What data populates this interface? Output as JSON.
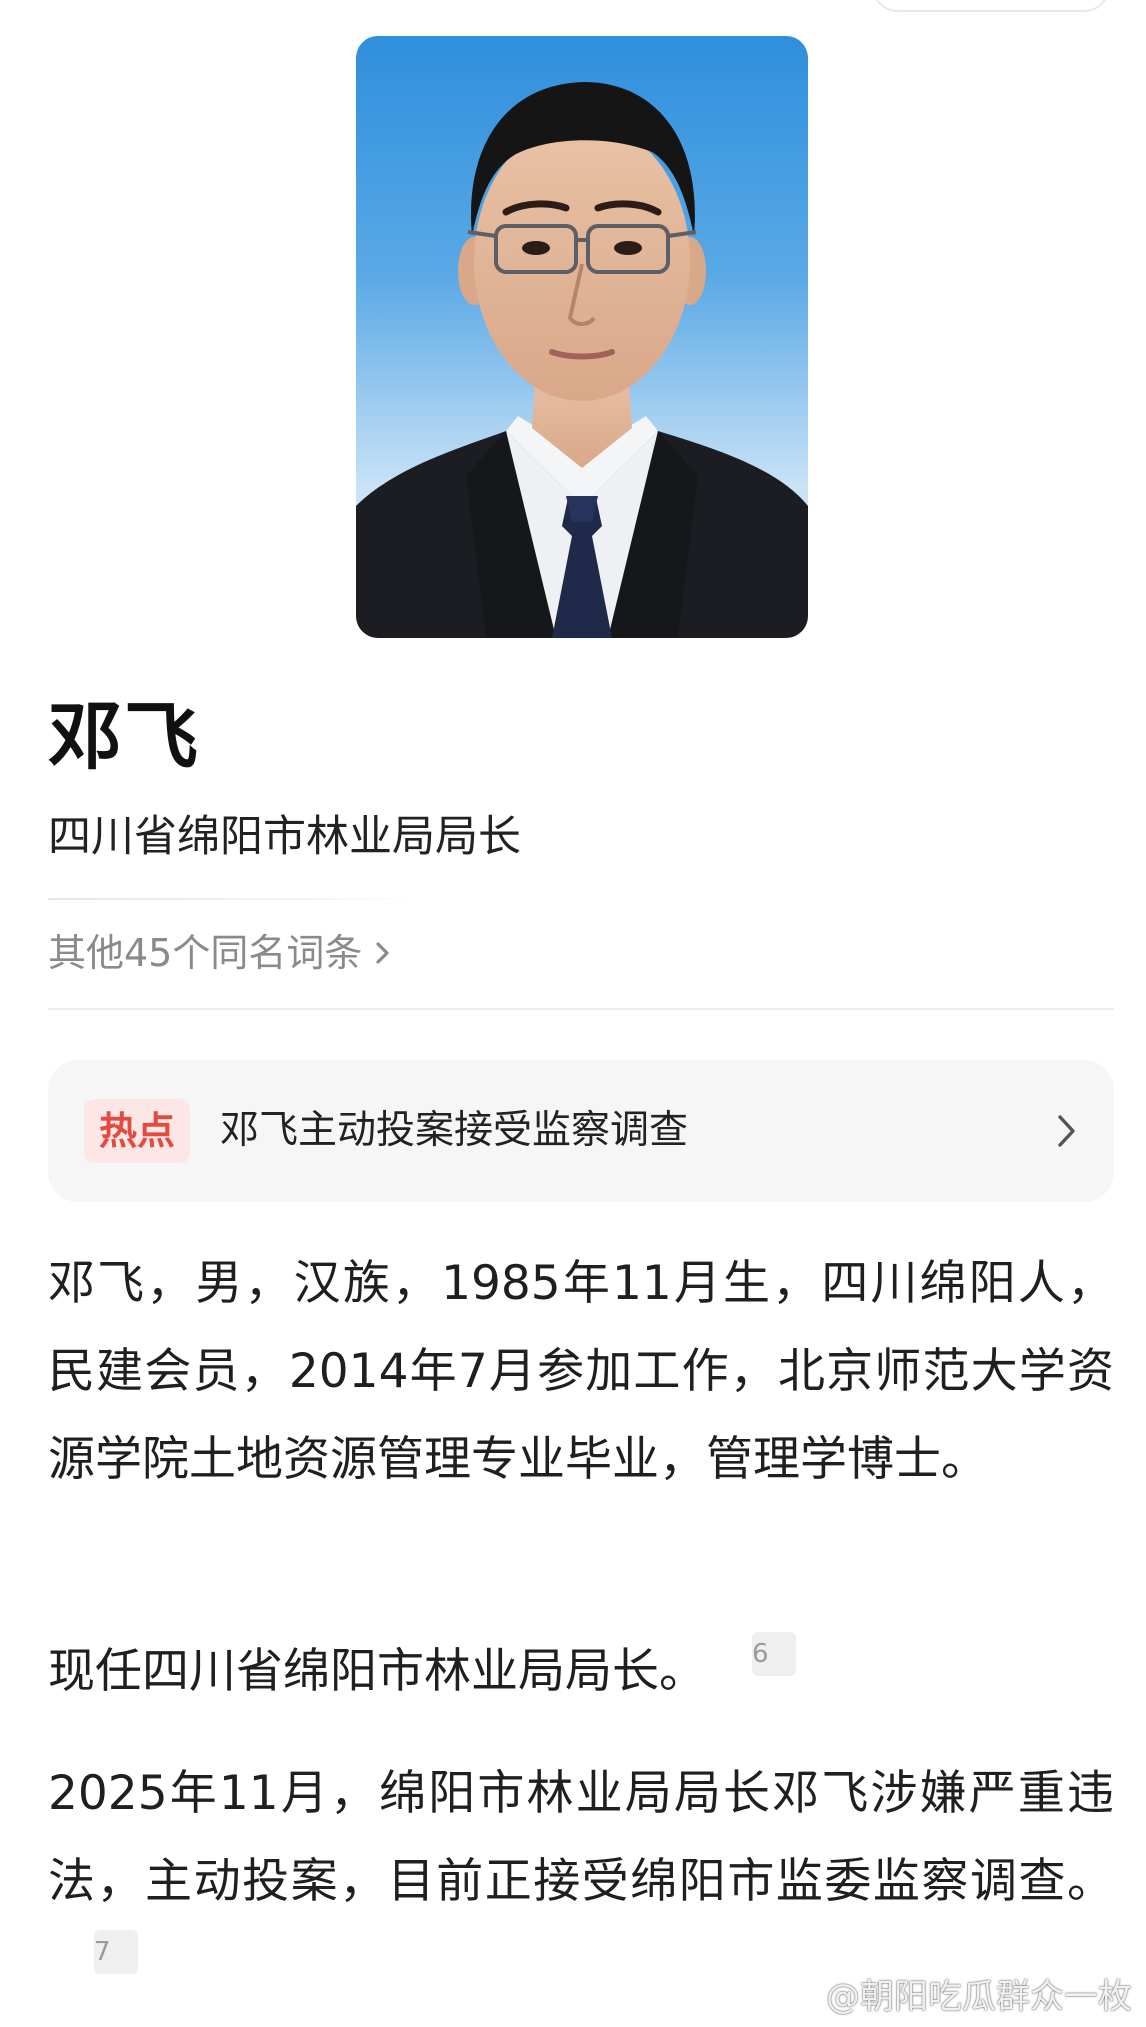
{
  "entry": {
    "name": "邓飞",
    "subtitle": "四川省绵阳市林业局局长",
    "same_name_link": "其他45个同名词条"
  },
  "hot_topic": {
    "badge": "热点",
    "text": "邓飞主动投案接受监察调查"
  },
  "paragraphs": [
    {
      "text": "邓飞，男，汉族，1985年11月生，四川绵阳人，民建会员，2014年7月参加工作，北京师范大学资源学院土地资源管理专业毕业，管理学博士。"
    },
    {
      "text": "现任四川省绵阳市林业局局长。",
      "ref": "6"
    },
    {
      "text": "2025年11月，绵阳市林业局局长邓飞涉嫌严重违法，主动投案，目前正接受绵阳市监委监察调查。",
      "ref": "7"
    }
  ],
  "watermark": {
    "text": "@朝阳吃瓜群众一枚",
    "icon": "weibo-icon"
  },
  "icons": {
    "same_name_chevron": "chevron-right-icon",
    "hot_chevron": "chevron-right-icon"
  },
  "colors": {
    "hot_badge_bg": "#fde7e6",
    "hot_badge_text": "#e54a3f",
    "photo_bg_top": "#2f8fdc"
  }
}
